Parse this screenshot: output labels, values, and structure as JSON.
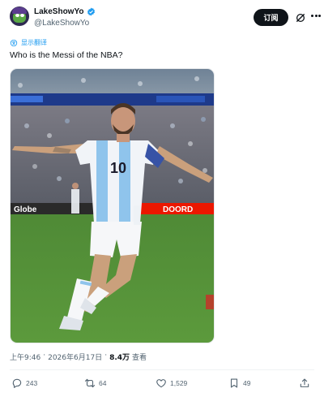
{
  "author": {
    "display_name": "LakeShowYo",
    "handle": "@LakeShowYo",
    "verified_icon": "verified-badge-icon",
    "accent": "#1d9bf0"
  },
  "header": {
    "follow_label": "订阅",
    "grok_icon": "grok-icon",
    "more_icon": "more-icon"
  },
  "translate": {
    "label": "显示翻译",
    "icon": "translate-icon"
  },
  "tweet": {
    "text": "Who is the Messi of the NBA?",
    "media": {
      "jersey_number": "10",
      "banner_text_left": "Globe",
      "banner_text_right": "DOORD"
    }
  },
  "meta": {
    "time": "上午9:46",
    "separator": "·",
    "date": "2026年6月17日",
    "views_count": "8.4万",
    "views_label": "查看"
  },
  "actions": {
    "replies": "243",
    "reposts": "64",
    "likes": "1,529",
    "bookmarks": "49"
  }
}
